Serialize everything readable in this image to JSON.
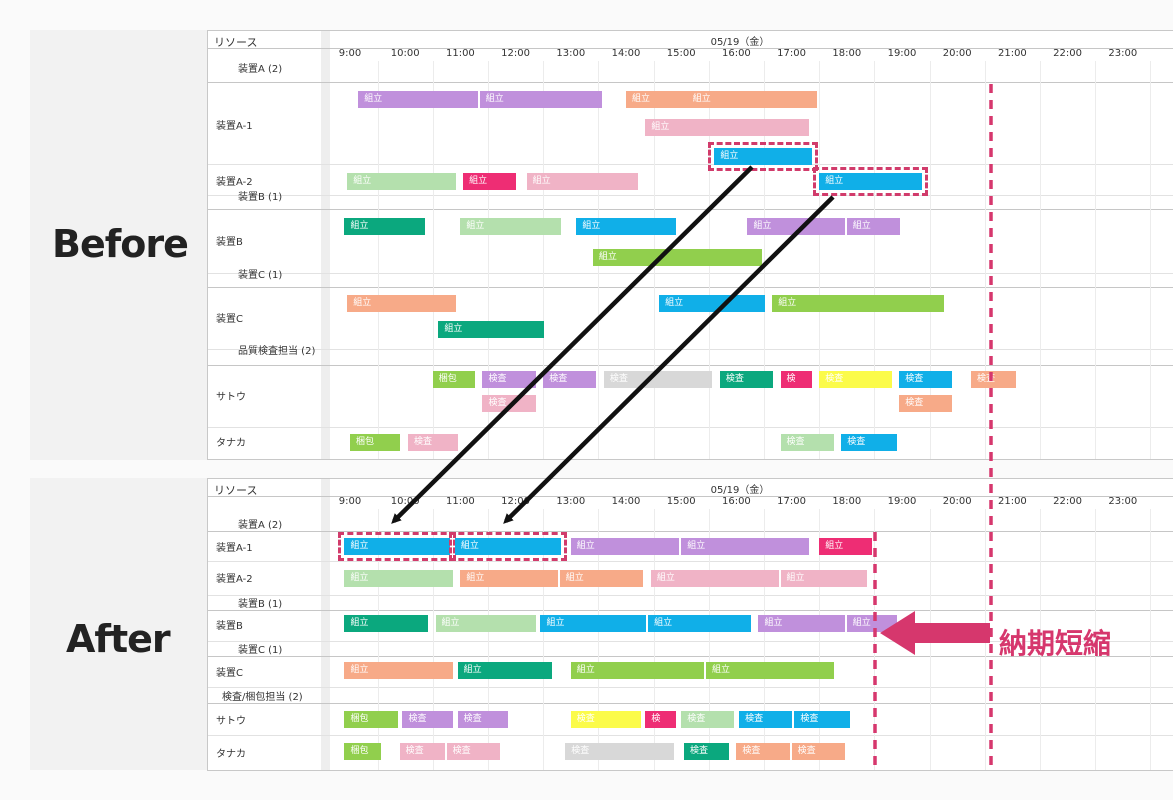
{
  "colors": {
    "purple": "#c090dc",
    "salmon": "#f7aa88",
    "pink": "#f0b3c6",
    "blue": "#10afe8",
    "lightgreen": "#b4e0ad",
    "magenta": "#ee2d74",
    "teal": "#0ba87e",
    "green": "#91cf4d",
    "gray": "#d8d8d8",
    "yellow": "#fbfb4a",
    "accent": "#d6376d",
    "arrow": "#111111"
  },
  "before": {
    "label": "Before",
    "header": {
      "resource": "リソース",
      "date": "05/19（金）"
    },
    "hours": [
      "9:00",
      "10:00",
      "11:00",
      "12:00",
      "13:00",
      "14:00",
      "15:00",
      "16:00",
      "17:00",
      "18:00",
      "19:00",
      "20:00",
      "21:00",
      "22:00",
      "23:00"
    ],
    "groups": [
      "装置A (2)",
      "装置B (1)",
      "装置C (1)",
      "品質検査担当 (2)"
    ],
    "rows": [
      "装置A-1",
      "装置A-2",
      "装置B",
      "装置C",
      "サトウ",
      "タナカ"
    ],
    "bars": [
      {
        "t": "組立",
        "c": "purple",
        "s": 9.15,
        "e": 11.35,
        "r": 0,
        "l": 0
      },
      {
        "t": "組立",
        "c": "purple",
        "s": 11.35,
        "e": 13.6,
        "r": 0,
        "l": 0
      },
      {
        "t": "組立",
        "c": "salmon",
        "s": 14.0,
        "e": 15.55,
        "r": 0,
        "l": 0
      },
      {
        "t": "組立",
        "c": "salmon",
        "s": 15.1,
        "e": 17.5,
        "r": 0,
        "l": 0
      },
      {
        "t": "組立",
        "c": "pink",
        "s": 14.35,
        "e": 17.35,
        "r": 0,
        "l": 1
      },
      {
        "t": "組立",
        "c": "blue",
        "s": 15.6,
        "e": 17.4,
        "r": 0,
        "l": 2,
        "hl": true
      },
      {
        "t": "組立",
        "c": "lightgreen",
        "s": 8.95,
        "e": 10.95,
        "r": 1,
        "l": 0
      },
      {
        "t": "組立",
        "c": "magenta",
        "s": 11.05,
        "e": 12.05,
        "r": 1,
        "l": 0
      },
      {
        "t": "組立",
        "c": "pink",
        "s": 12.2,
        "e": 14.25,
        "r": 1,
        "l": 0
      },
      {
        "t": "組立",
        "c": "blue",
        "s": 17.5,
        "e": 19.4,
        "r": 1,
        "l": 0,
        "hl": true
      },
      {
        "t": "組立",
        "c": "teal",
        "s": 8.9,
        "e": 10.4,
        "r": 2,
        "l": 0
      },
      {
        "t": "組立",
        "c": "lightgreen",
        "s": 11.0,
        "e": 12.85,
        "r": 2,
        "l": 0
      },
      {
        "t": "組立",
        "c": "blue",
        "s": 13.1,
        "e": 14.95,
        "r": 2,
        "l": 0
      },
      {
        "t": "組立",
        "c": "purple",
        "s": 16.2,
        "e": 18.0,
        "r": 2,
        "l": 0
      },
      {
        "t": "組立",
        "c": "purple",
        "s": 18.0,
        "e": 19.0,
        "r": 2,
        "l": 0
      },
      {
        "t": "組立",
        "c": "green",
        "s": 13.4,
        "e": 16.5,
        "r": 2,
        "l": 1
      },
      {
        "t": "組立",
        "c": "salmon",
        "s": 8.95,
        "e": 10.95,
        "r": 3,
        "l": 0
      },
      {
        "t": "組立",
        "c": "blue",
        "s": 14.6,
        "e": 16.55,
        "r": 3,
        "l": 0
      },
      {
        "t": "組立",
        "c": "green",
        "s": 16.65,
        "e": 19.8,
        "r": 3,
        "l": 0
      },
      {
        "t": "組立",
        "c": "teal",
        "s": 10.6,
        "e": 12.55,
        "r": 3,
        "l": 1
      },
      {
        "t": "梱包",
        "c": "green",
        "s": 10.5,
        "e": 11.3,
        "r": 4,
        "l": 0
      },
      {
        "t": "検査",
        "c": "purple",
        "s": 11.4,
        "e": 12.4,
        "r": 4,
        "l": 0
      },
      {
        "t": "検査",
        "c": "purple",
        "s": 12.5,
        "e": 13.5,
        "r": 4,
        "l": 0
      },
      {
        "t": "検査",
        "c": "gray",
        "s": 13.6,
        "e": 15.6,
        "r": 4,
        "l": 0
      },
      {
        "t": "検査",
        "c": "teal",
        "s": 15.7,
        "e": 16.7,
        "r": 4,
        "l": 0
      },
      {
        "t": "検",
        "c": "magenta",
        "s": 16.8,
        "e": 17.4,
        "r": 4,
        "l": 0
      },
      {
        "t": "検査",
        "c": "yellow",
        "s": 17.5,
        "e": 18.85,
        "r": 4,
        "l": 0
      },
      {
        "t": "検査",
        "c": "blue",
        "s": 18.95,
        "e": 19.95,
        "r": 4,
        "l": 0
      },
      {
        "t": "検査",
        "c": "salmon",
        "s": 20.25,
        "e": 21.1,
        "r": 4,
        "l": 0
      },
      {
        "t": "検査",
        "c": "pink",
        "s": 11.4,
        "e": 12.4,
        "r": 4,
        "l": 1
      },
      {
        "t": "検査",
        "c": "salmon",
        "s": 18.95,
        "e": 19.95,
        "r": 4,
        "l": 1
      },
      {
        "t": "梱包",
        "c": "green",
        "s": 9.0,
        "e": 9.95,
        "r": 5,
        "l": 0
      },
      {
        "t": "検査",
        "c": "pink",
        "s": 10.05,
        "e": 11.0,
        "r": 5,
        "l": 0
      },
      {
        "t": "検査",
        "c": "lightgreen",
        "s": 16.8,
        "e": 17.8,
        "r": 5,
        "l": 0
      },
      {
        "t": "検査",
        "c": "blue",
        "s": 17.9,
        "e": 18.95,
        "r": 5,
        "l": 0
      }
    ]
  },
  "after": {
    "label": "After",
    "header": {
      "resource": "リソース",
      "date": "05/19（金）"
    },
    "hours": [
      "9:00",
      "10:00",
      "11:00",
      "12:00",
      "13:00",
      "14:00",
      "15:00",
      "16:00",
      "17:00",
      "18:00",
      "19:00",
      "20:00",
      "21:00",
      "22:00",
      "23:00"
    ],
    "groups": [
      "装置A (2)",
      "装置B (1)",
      "装置C (1)",
      "検査/梱包担当 (2)"
    ],
    "rows": [
      "装置A-1",
      "装置A-2",
      "装置B",
      "装置C",
      "サトウ",
      "タナカ"
    ],
    "bars": [
      {
        "t": "組立",
        "c": "blue",
        "s": 8.9,
        "e": 10.85,
        "r": 0,
        "l": 0,
        "hl": true
      },
      {
        "t": "組立",
        "c": "blue",
        "s": 10.9,
        "e": 12.85,
        "r": 0,
        "l": 0,
        "hl": true
      },
      {
        "t": "組立",
        "c": "purple",
        "s": 13.0,
        "e": 15.0,
        "r": 0,
        "l": 0
      },
      {
        "t": "組立",
        "c": "purple",
        "s": 15.0,
        "e": 17.35,
        "r": 0,
        "l": 0
      },
      {
        "t": "組立",
        "c": "magenta",
        "s": 17.5,
        "e": 18.5,
        "r": 0,
        "l": 0
      },
      {
        "t": "組立",
        "c": "lightgreen",
        "s": 8.9,
        "e": 10.9,
        "r": 1,
        "l": 0
      },
      {
        "t": "組立",
        "c": "salmon",
        "s": 11.0,
        "e": 12.8,
        "r": 1,
        "l": 0
      },
      {
        "t": "組立",
        "c": "salmon",
        "s": 12.8,
        "e": 14.35,
        "r": 1,
        "l": 0
      },
      {
        "t": "組立",
        "c": "pink",
        "s": 14.45,
        "e": 16.8,
        "r": 1,
        "l": 0
      },
      {
        "t": "組立",
        "c": "pink",
        "s": 16.8,
        "e": 18.4,
        "r": 1,
        "l": 0
      },
      {
        "t": "組立",
        "c": "teal",
        "s": 8.9,
        "e": 10.45,
        "r": 2,
        "l": 0
      },
      {
        "t": "組立",
        "c": "lightgreen",
        "s": 10.55,
        "e": 12.4,
        "r": 2,
        "l": 0
      },
      {
        "t": "組立",
        "c": "blue",
        "s": 12.45,
        "e": 14.4,
        "r": 2,
        "l": 0
      },
      {
        "t": "組立",
        "c": "blue",
        "s": 14.4,
        "e": 16.3,
        "r": 2,
        "l": 0
      },
      {
        "t": "組立",
        "c": "purple",
        "s": 16.4,
        "e": 18.0,
        "r": 2,
        "l": 0
      },
      {
        "t": "組立",
        "c": "purple",
        "s": 18.0,
        "e": 18.95,
        "r": 2,
        "l": 0
      },
      {
        "t": "組立",
        "c": "salmon",
        "s": 8.9,
        "e": 10.9,
        "r": 3,
        "l": 0
      },
      {
        "t": "組立",
        "c": "teal",
        "s": 10.95,
        "e": 12.7,
        "r": 3,
        "l": 0
      },
      {
        "t": "組立",
        "c": "green",
        "s": 13.0,
        "e": 15.45,
        "r": 3,
        "l": 0
      },
      {
        "t": "組立",
        "c": "green",
        "s": 15.45,
        "e": 17.8,
        "r": 3,
        "l": 0
      },
      {
        "t": "梱包",
        "c": "green",
        "s": 8.9,
        "e": 9.9,
        "r": 4,
        "l": 0
      },
      {
        "t": "検査",
        "c": "purple",
        "s": 9.95,
        "e": 10.9,
        "r": 4,
        "l": 0
      },
      {
        "t": "検査",
        "c": "purple",
        "s": 10.95,
        "e": 11.9,
        "r": 4,
        "l": 0
      },
      {
        "t": "検査",
        "c": "yellow",
        "s": 13.0,
        "e": 14.3,
        "r": 4,
        "l": 0
      },
      {
        "t": "検",
        "c": "magenta",
        "s": 14.35,
        "e": 14.95,
        "r": 4,
        "l": 0
      },
      {
        "t": "検査",
        "c": "lightgreen",
        "s": 15.0,
        "e": 16.0,
        "r": 4,
        "l": 0
      },
      {
        "t": "検査",
        "c": "blue",
        "s": 16.05,
        "e": 17.05,
        "r": 4,
        "l": 0
      },
      {
        "t": "検査",
        "c": "blue",
        "s": 17.05,
        "e": 18.1,
        "r": 4,
        "l": 0
      },
      {
        "t": "梱包",
        "c": "green",
        "s": 8.9,
        "e": 9.6,
        "r": 5,
        "l": 0
      },
      {
        "t": "検査",
        "c": "pink",
        "s": 9.9,
        "e": 10.75,
        "r": 5,
        "l": 0
      },
      {
        "t": "検査",
        "c": "pink",
        "s": 10.75,
        "e": 11.75,
        "r": 5,
        "l": 0
      },
      {
        "t": "検査",
        "c": "gray",
        "s": 12.9,
        "e": 14.9,
        "r": 5,
        "l": 0
      },
      {
        "t": "検査",
        "c": "teal",
        "s": 15.05,
        "e": 15.9,
        "r": 5,
        "l": 0
      },
      {
        "t": "検査",
        "c": "salmon",
        "s": 16.0,
        "e": 17.0,
        "r": 5,
        "l": 0
      },
      {
        "t": "検査",
        "c": "salmon",
        "s": 17.0,
        "e": 18.0,
        "r": 5,
        "l": 0
      }
    ]
  },
  "annotation": {
    "label": "納期短縮"
  }
}
